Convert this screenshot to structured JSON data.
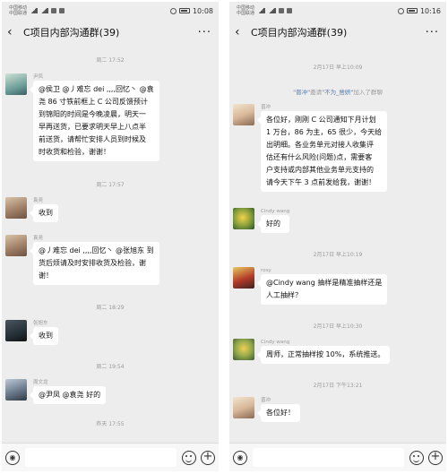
{
  "left": {
    "status": {
      "carrier1": "中国移动",
      "carrier2": "中国联通",
      "time": "10:08"
    },
    "title": "C项目内部沟通群(39)",
    "timestamps": [
      "周二 17:52",
      "周二 17:57",
      "周二 18:29",
      "周二 19:54",
      "昨天 17:55"
    ],
    "messages": [
      {
        "sender": "尹凤",
        "lines": [
          "@侯卫 @丿难忘 dei ,,,,回忆丶 @袁",
          "尧 86 寸铁前框上 C 公司反馈预计",
          "到锦阳的时间是今晚凌晨，明天一",
          "早再送货，已要求明天早上八点半",
          "前送货，请帮忙安排人员到时候及",
          "时收货和检验，谢谢！"
        ]
      },
      {
        "sender": "袁尧",
        "lines": [
          "收到"
        ]
      },
      {
        "sender": "袁尧",
        "lines": [
          "@丿难忘 dei ,,,,回忆丶 @张旭东 到",
          "货后烦请及时安排收货及检验，谢",
          "谢！"
        ]
      },
      {
        "sender": "张旭东",
        "lines": [
          "收到"
        ]
      },
      {
        "sender": "周文龙",
        "lines": [
          "@尹凤 @袁尧 好的"
        ]
      }
    ]
  },
  "right": {
    "status": {
      "carrier1": "中国移动",
      "carrier2": "中国联通",
      "time": "10:16"
    },
    "title": "C项目内部沟通群(39)",
    "timestamps": [
      "2月17日 早上10:09",
      "2月17日 早上10:19",
      "2月17日 早上10:30",
      "2月17日 下午13:21"
    ],
    "notice": {
      "name1": "\"晋冲\"",
      "mid": "邀请",
      "name2": "\"不为_凿妍\"",
      "end": "加入了群聊"
    },
    "messages": [
      {
        "sender": "晋冲",
        "lines": [
          "各位好，刚刚 C 公司通知下月计划",
          "1 万台，86 为主，65 很少，今天给",
          "出明细。各业务单元对接人收集评",
          "估还有什么风险(问题)点，需要客",
          "户支持或内部其他业务单元支持的",
          "请今天下午 3 点前发给我，谢谢！"
        ]
      },
      {
        "sender": "Cindy wang",
        "lines": [
          "好的"
        ]
      },
      {
        "sender": "rosy",
        "lines": [
          "@Cindy wang  抽样是精准抽样还是",
          "人工抽样？"
        ]
      },
      {
        "sender": "Cindy wang",
        "lines": [
          "周师，正常抽样按 10%，系统推送。"
        ]
      },
      {
        "sender": "晋冲",
        "lines": [
          "各位好！"
        ]
      }
    ]
  },
  "icons": {
    "back": "chevron-left-icon",
    "more": "more-dots-icon",
    "voice": "voice-icon",
    "emoji": "emoji-icon",
    "plus": "plus-icon"
  },
  "glyphs": {
    "back": "‹",
    "more": "···",
    "voice": "◉",
    "plus": "+"
  }
}
